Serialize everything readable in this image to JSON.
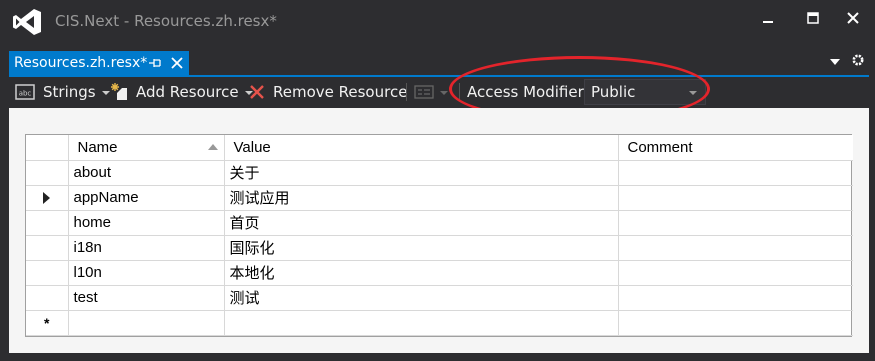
{
  "window": {
    "title": "CIS.Next - Resources.zh.resx*",
    "buttons": [
      "minimize",
      "maximize",
      "close"
    ]
  },
  "tabs": [
    {
      "label": "Resources.zh.resx*",
      "active": true
    }
  ],
  "toolbar": {
    "strings_label": "Strings",
    "add_label": "Add Resource",
    "remove_label": "Remove Resource",
    "access_modifier_label": "Access Modifier:",
    "access_modifier_value": "Public"
  },
  "grid": {
    "columns": [
      "Name",
      "Value",
      "Comment"
    ],
    "rows": [
      {
        "name": "about",
        "value": "关于",
        "comment": "",
        "current": false
      },
      {
        "name": "appName",
        "value": "测试应用",
        "comment": "",
        "current": true
      },
      {
        "name": "home",
        "value": "首页",
        "comment": "",
        "current": false
      },
      {
        "name": "i18n",
        "value": "国际化",
        "comment": "",
        "current": false
      },
      {
        "name": "l10n",
        "value": "本地化",
        "comment": "",
        "current": false
      },
      {
        "name": "test",
        "value": "测试",
        "comment": "",
        "current": false
      }
    ],
    "new_row_marker": "*"
  },
  "colors": {
    "accent": "#007acc",
    "annotation": "#e3242b",
    "chrome": "#2d2d30",
    "grid_background": "#f5f5f5"
  },
  "icons": {
    "app": "visual-studio-icon",
    "strings": "strings-icon",
    "add": "add-resource-icon",
    "remove": "remove-x-icon",
    "view": "view-icon",
    "pin": "pin-icon",
    "close": "close-icon",
    "settings": "gear-icon"
  }
}
